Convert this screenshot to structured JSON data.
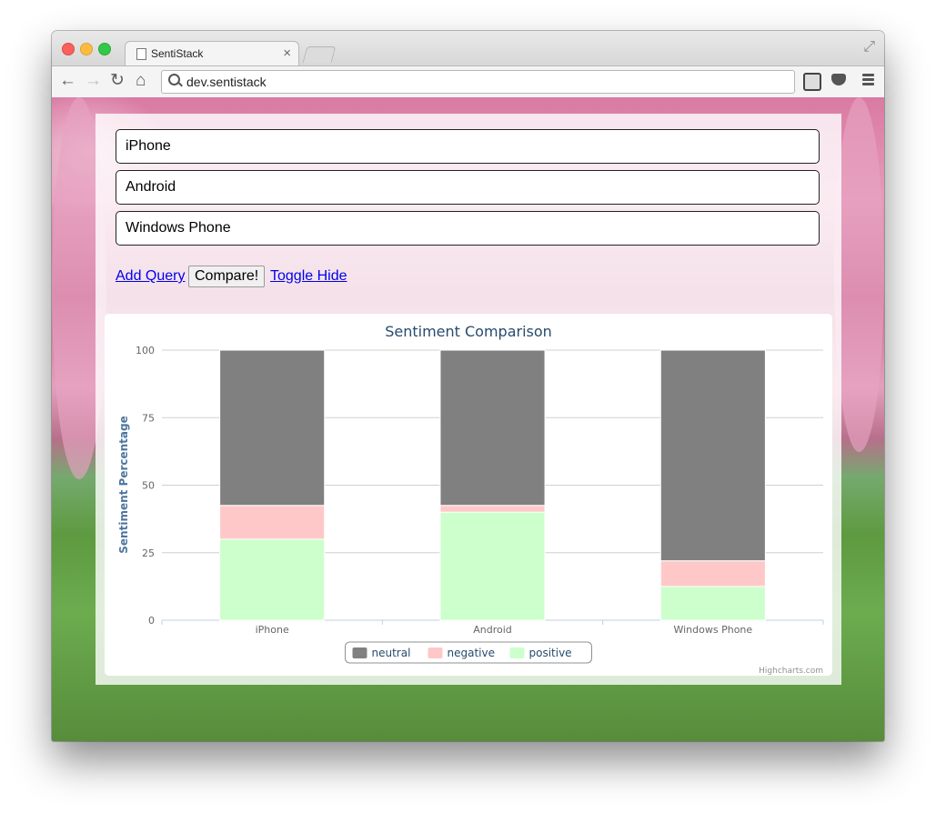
{
  "browser": {
    "tab_title": "SentiStack",
    "tab_close": "×",
    "url": "dev.sentistack"
  },
  "queries": [
    {
      "value": "iPhone"
    },
    {
      "value": "Android"
    },
    {
      "value": "Windows Phone"
    }
  ],
  "actions": {
    "add_query": "Add Query",
    "compare": "Compare!",
    "toggle_hide": "Toggle Hide"
  },
  "chart_data": {
    "type": "bar",
    "stacked": true,
    "title": "Sentiment Comparison",
    "ylabel": "Sentiment Percentage",
    "xlabel": "",
    "categories": [
      "iPhone",
      "Android",
      "Windows Phone"
    ],
    "ylim": [
      0,
      100
    ],
    "yticks": [
      0,
      25,
      50,
      75,
      100
    ],
    "series": [
      {
        "name": "positive",
        "color": "#ccffcc",
        "values": [
          30,
          40,
          12.5
        ]
      },
      {
        "name": "negative",
        "color": "#ffc8c8",
        "values": [
          12.5,
          2.5,
          9.5
        ]
      },
      {
        "name": "neutral",
        "color": "#808080",
        "values": [
          57.5,
          57.5,
          78
        ]
      }
    ],
    "legend_order": [
      "neutral",
      "negative",
      "positive"
    ],
    "legend_position": "bottom-center",
    "grid": true,
    "credits": "Highcharts.com"
  }
}
